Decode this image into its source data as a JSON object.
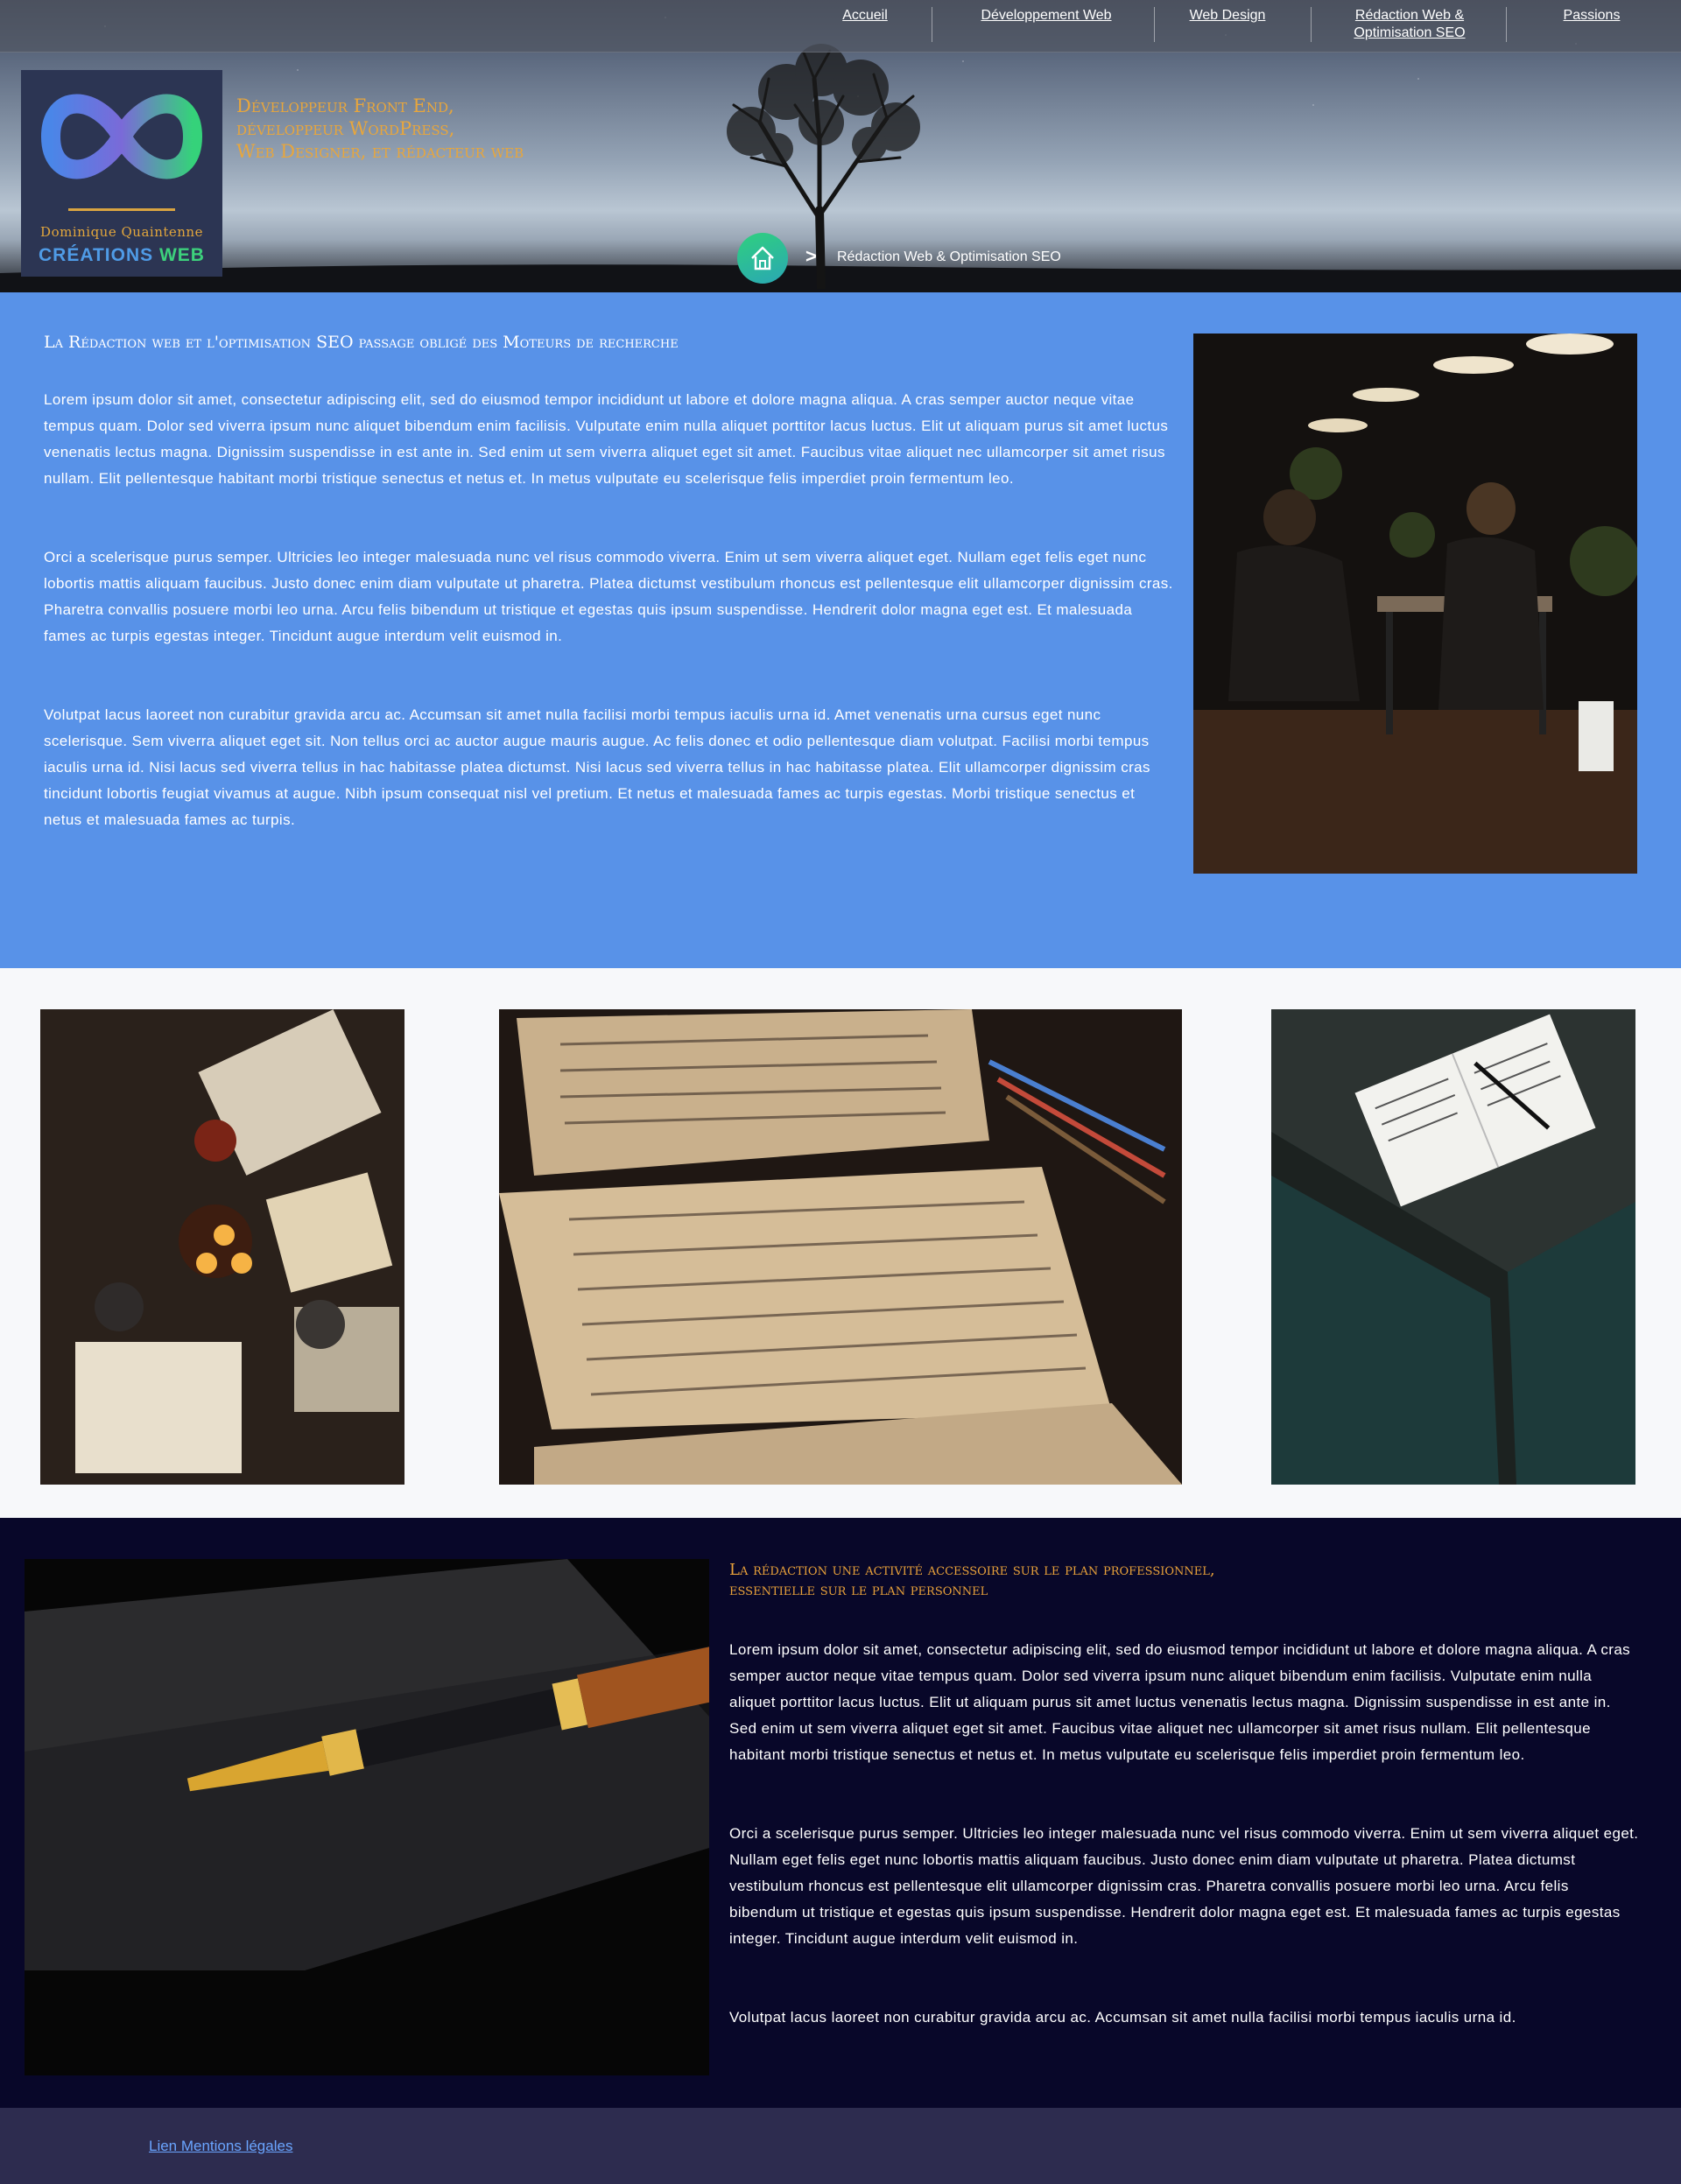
{
  "nav": {
    "items": [
      {
        "label": "Accueil"
      },
      {
        "label": "Développement Web"
      },
      {
        "label": "Web Design"
      },
      {
        "label": "Rédaction Web &",
        "label2": "Optimisation SEO"
      },
      {
        "label": "Passions"
      }
    ]
  },
  "logo": {
    "name": "Dominique Quaintenne",
    "brand_word1": "CRÉATIONS",
    "brand_word2": "WEB"
  },
  "header": {
    "tagline1": "Développeur Front End,",
    "tagline2": "développeur WordPress,",
    "tagline3": "Web Designer, et rédacteur web",
    "breadcrumb_separator": ">",
    "breadcrumb_current": "Rédaction Web & Optimisation SEO"
  },
  "section1": {
    "title": "La Rédaction web et l'optimisation SEO passage obligé des Moteurs de recherche",
    "paragraphs": [
      "Lorem ipsum dolor sit amet, consectetur adipiscing elit, sed do eiusmod tempor incididunt ut labore et dolore magna aliqua. A cras semper auctor neque vitae tempus quam. Dolor sed viverra ipsum nunc aliquet bibendum enim facilisis. Vulputate enim nulla aliquet porttitor lacus luctus. Elit ut aliquam purus sit amet luctus venenatis lectus magna. Dignissim suspendisse in est ante in. Sed enim ut sem viverra aliquet eget sit amet. Faucibus vitae aliquet nec ullamcorper sit amet risus nullam. Elit pellentesque habitant morbi tristique senectus et netus et. In metus vulputate eu scelerisque felis imperdiet proin fermentum leo.",
      "Orci a scelerisque purus semper. Ultricies leo integer malesuada nunc vel risus commodo viverra. Enim ut sem viverra aliquet eget. Nullam eget felis eget nunc lobortis mattis aliquam faucibus. Justo donec enim diam vulputate ut pharetra. Platea dictumst vestibulum rhoncus est pellentesque elit ullamcorper dignissim cras. Pharetra convallis posuere morbi leo urna. Arcu felis bibendum ut tristique et egestas quis ipsum suspendisse. Hendrerit dolor magna eget est. Et malesuada fames ac turpis egestas integer. Tincidunt augue interdum velit euismod in.",
      "Volutpat lacus laoreet non curabitur gravida arcu ac. Accumsan sit amet nulla facilisi morbi tempus iaculis urna id. Amet venenatis urna cursus eget nunc scelerisque. Sem viverra aliquet eget sit. Non tellus orci ac auctor augue mauris augue. Ac felis donec et odio pellentesque diam volutpat. Facilisi morbi tempus iaculis urna id. Nisi lacus sed viverra tellus in hac habitasse platea dictumst. Nisi lacus sed viverra tellus in hac habitasse platea. Elit ullamcorper dignissim cras tincidunt lobortis feugiat vivamus at augue. Nibh ipsum consequat nisl vel pretium. Et netus et malesuada fames ac turpis egestas. Morbi tristique senectus et netus et malesuada fames ac turpis."
    ]
  },
  "section2": {
    "title_line1": "La rédaction une activité accessoire sur le plan professionnel,",
    "title_line2": "essentielle sur le plan personnel",
    "paragraphs": [
      "Lorem ipsum dolor sit amet, consectetur adipiscing elit, sed do eiusmod tempor incididunt ut labore et dolore magna aliqua. A cras semper auctor neque vitae tempus quam. Dolor sed viverra ipsum nunc aliquet bibendum enim facilisis. Vulputate enim nulla aliquet porttitor lacus luctus. Elit ut aliquam purus sit amet luctus venenatis lectus magna. Dignissim suspendisse in est ante in. Sed enim ut sem viverra aliquet eget sit amet. Faucibus vitae aliquet nec ullamcorper sit amet risus nullam. Elit pellentesque habitant morbi tristique senectus et netus et. In metus vulputate eu scelerisque felis imperdiet proin fermentum leo.",
      "Orci a scelerisque purus semper. Ultricies leo integer malesuada nunc vel risus commodo viverra. Enim ut sem viverra aliquet eget. Nullam eget felis eget nunc lobortis mattis aliquam faucibus. Justo donec enim diam vulputate ut pharetra. Platea dictumst vestibulum rhoncus est pellentesque elit ullamcorper dignissim cras. Pharetra convallis posuere morbi leo urna. Arcu felis bibendum ut tristique et egestas quis ipsum suspendisse. Hendrerit dolor magna eget est. Et malesuada fames ac turpis egestas integer. Tincidunt augue interdum velit euismod in.",
      "Volutpat lacus laoreet non curabitur gravida arcu ac. Accumsan sit amet nulla facilisi morbi tempus iaculis urna id."
    ]
  },
  "footer": {
    "link": "Lien Mentions légales"
  },
  "colors": {
    "blue_section": "#5892e8",
    "dark_section": "#080729",
    "footer": "#2d2c4f",
    "accent_orange": "#e8a13a",
    "logo_green": "#3dd17c",
    "logo_blue": "#4f9be6"
  },
  "icons": [
    "infinity-logo-icon",
    "home-icon"
  ]
}
